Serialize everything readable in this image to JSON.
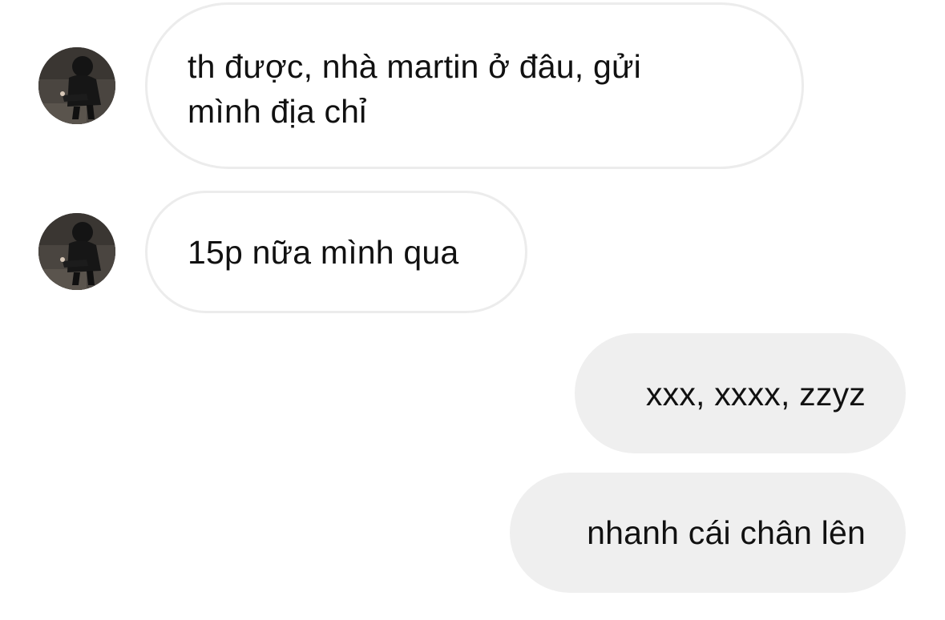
{
  "conversation": {
    "messages": [
      {
        "direction": "incoming",
        "text": "th được, nhà martin ở đâu, gửi mình địa chỉ",
        "lines": [
          "th được, nhà martin ở đâu, gửi",
          "mình địa chỉ"
        ]
      },
      {
        "direction": "incoming",
        "text": "15p nữa mình qua"
      },
      {
        "direction": "outgoing",
        "text": "xxx, xxxx, zzyz"
      },
      {
        "direction": "outgoing",
        "text": "nhanh cái chân lên"
      }
    ]
  },
  "theme": {
    "background": "#ffffff",
    "incoming_bubble": "#ffffff",
    "incoming_border": "#ececec",
    "outgoing_bubble": "#efefef",
    "text": "#111111"
  },
  "icons": {
    "avatar": "profile-photo-avatar"
  }
}
